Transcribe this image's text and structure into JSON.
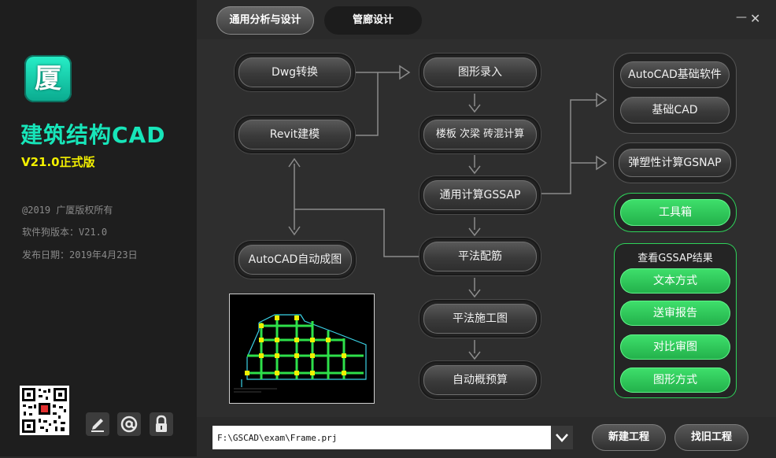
{
  "colors": {
    "accent_teal": "#17e5b9",
    "version_yellow": "#f3f000",
    "green_button": "#2ec655",
    "sidebar_bg": "#1e1e1e",
    "main_bg": "#2e2e2e"
  },
  "sidebar": {
    "logo_glyph": "厦",
    "app_name": "建筑结构CAD",
    "version": "V21.0正式版",
    "copyright": "@2019 广厦版权所有",
    "dog_version": "软件狗版本：V21.0",
    "release_date": "发布日期：2019年4月23日",
    "tools": [
      {
        "icon": "pencil-icon",
        "glyph": "✎"
      },
      {
        "icon": "at-icon",
        "glyph": "@"
      },
      {
        "icon": "lock-icon",
        "glyph": "🔒"
      }
    ]
  },
  "tabs": [
    {
      "label": "通用分析与设计",
      "active": true
    },
    {
      "label": "管廊设计",
      "active": false
    }
  ],
  "window": {
    "minimize": "—",
    "close": "✕"
  },
  "flow": {
    "left": {
      "dwg": "Dwg转换",
      "revit": "Revit建模",
      "autocad_draw": "AutoCAD自动成图"
    },
    "center": {
      "graph_input": "图形录入",
      "slab_calc": "楼板 次梁 砖混计算",
      "gssap": "通用计算GSSAP",
      "rebar": "平法配筋",
      "drawing": "平法施工图",
      "budget": "自动概预算"
    },
    "right": {
      "autocad_base": "AutoCAD基础软件",
      "base_cad": "基础CAD",
      "gsnap": "弹塑性计算GSNAP",
      "toolbox": "工具箱"
    },
    "results": {
      "title": "查看GSSAP结果",
      "items": [
        "文本方式",
        "送审报告",
        "对比审图",
        "图形方式"
      ]
    }
  },
  "bottom": {
    "project_path": "F:\\GSCAD\\exam\\Frame.prj",
    "new_project": "新建工程",
    "open_project": "找旧工程"
  }
}
